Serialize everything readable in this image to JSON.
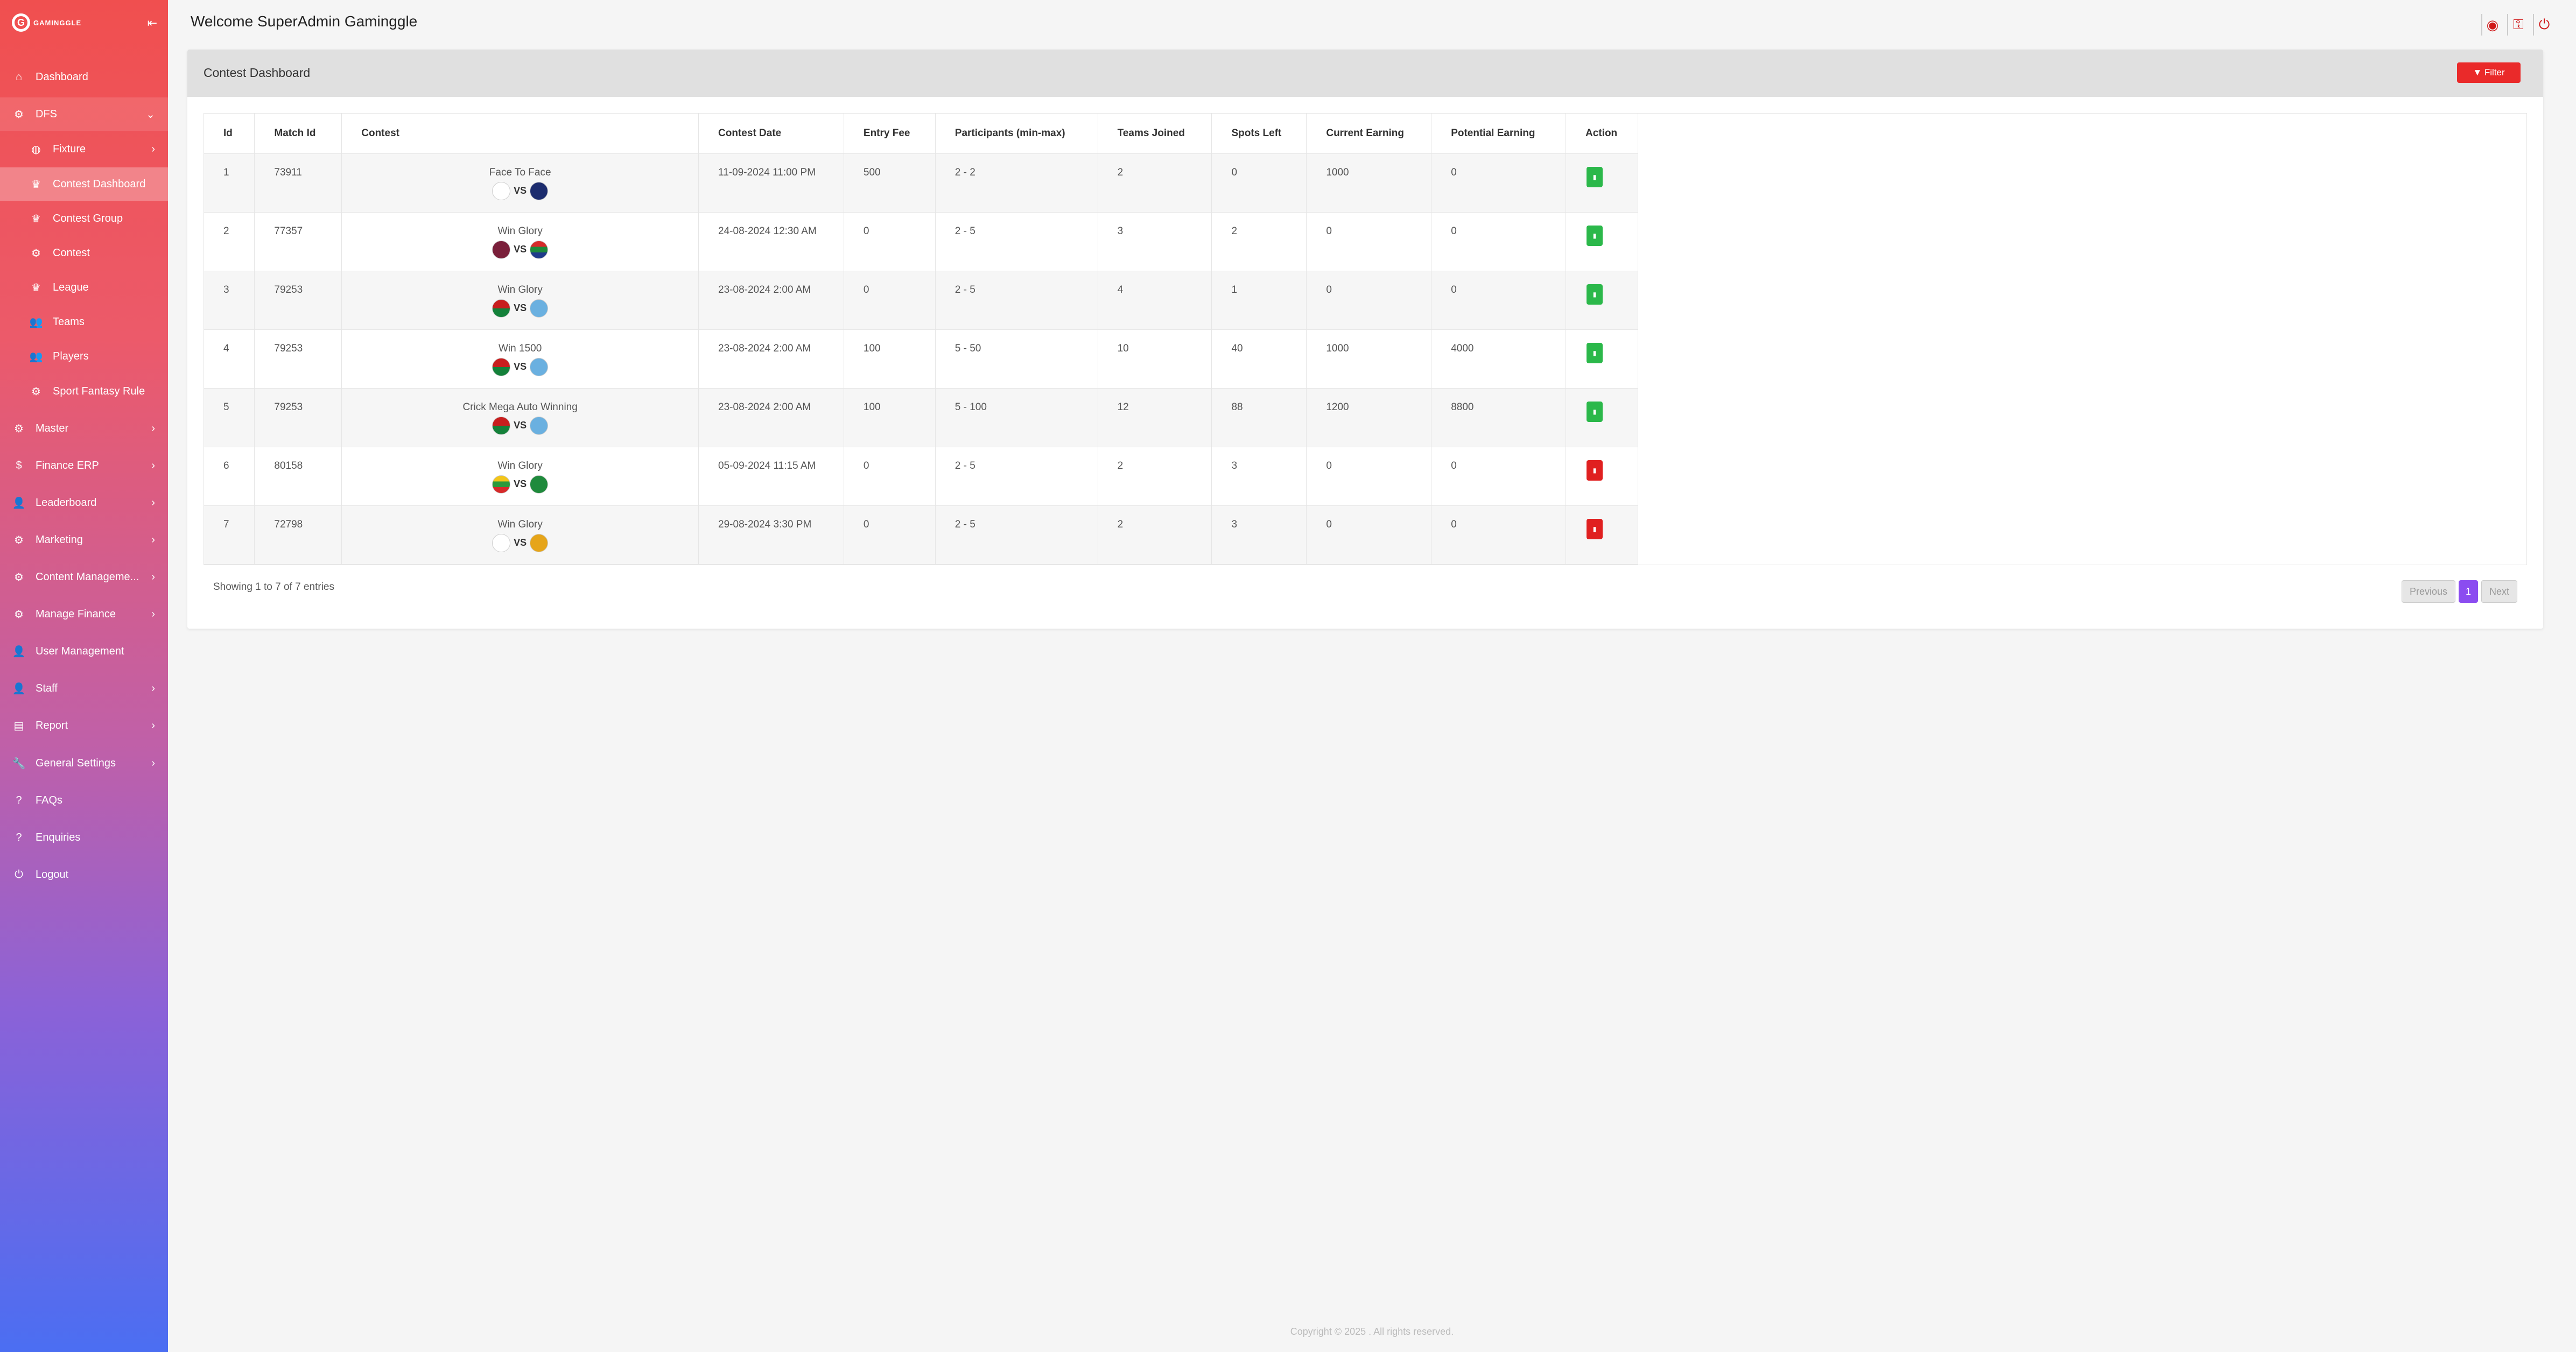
{
  "brand": {
    "logo_letter": "G",
    "name": "GAMINGGLE"
  },
  "sidebar": {
    "items": [
      {
        "name": "dashboard",
        "label": "Dashboard",
        "icon": "home-icon"
      },
      {
        "name": "dfs",
        "label": "DFS",
        "icon": "gear-icon",
        "expanded": true
      },
      {
        "name": "fixture",
        "label": "Fixture",
        "icon": "globe-icon",
        "sub": true
      },
      {
        "name": "contest-dashboard",
        "label": "Contest Dashboard",
        "icon": "trophy-icon",
        "sub": true,
        "active": true
      },
      {
        "name": "contest-group",
        "label": "Contest Group",
        "icon": "trophy-icon",
        "sub": true
      },
      {
        "name": "contest",
        "label": "Contest",
        "icon": "gear-icon",
        "sub": true
      },
      {
        "name": "league",
        "label": "League",
        "icon": "trophy-icon",
        "sub": true
      },
      {
        "name": "teams",
        "label": "Teams",
        "icon": "users-icon",
        "sub": true
      },
      {
        "name": "players",
        "label": "Players",
        "icon": "users-icon",
        "sub": true
      },
      {
        "name": "sport-fantasy-rule",
        "label": "Sport Fantasy Rule",
        "icon": "gear-icon",
        "sub": true
      },
      {
        "name": "master",
        "label": "Master",
        "icon": "cogs-icon"
      },
      {
        "name": "finance-erp",
        "label": "Finance ERP",
        "icon": "dollar-icon"
      },
      {
        "name": "leaderboard",
        "label": "Leaderboard",
        "icon": "user-icon"
      },
      {
        "name": "marketing",
        "label": "Marketing",
        "icon": "cogs-icon"
      },
      {
        "name": "content-management",
        "label": "Content Manageme...",
        "icon": "cogs-icon"
      },
      {
        "name": "manage-finance",
        "label": "Manage Finance",
        "icon": "cogs-icon"
      },
      {
        "name": "user-management",
        "label": "User Management",
        "icon": "user-icon"
      },
      {
        "name": "staff",
        "label": "Staff",
        "icon": "user-icon"
      },
      {
        "name": "report",
        "label": "Report",
        "icon": "file-icon"
      },
      {
        "name": "general-settings",
        "label": "General Settings",
        "icon": "wrench-icon"
      },
      {
        "name": "faqs",
        "label": "FAQs",
        "icon": "question-icon"
      },
      {
        "name": "enquiries",
        "label": "Enquiries",
        "icon": "question-icon"
      },
      {
        "name": "logout",
        "label": "Logout",
        "icon": "power-icon"
      }
    ]
  },
  "header": {
    "welcome": "Welcome SuperAdmin Gaminggle"
  },
  "card": {
    "title": "Contest Dashboard",
    "filter_label": "Filter"
  },
  "table": {
    "columns": [
      "Id",
      "Match Id",
      "Contest",
      "Contest Date",
      "Entry Fee",
      "Participants (min-max)",
      "Teams Joined",
      "Spots Left",
      "Current Earning",
      "Potential Earning",
      "Action"
    ],
    "rows": [
      {
        "id": "1",
        "match_id": "73911",
        "contest": "Face To Face",
        "team1_flag": "england",
        "team2_flag": "australia",
        "date": "11-09-2024 11:00 PM",
        "entry_fee": "500",
        "participants": "2 - 2",
        "joined": "2",
        "spots_left": "0",
        "current": "1000",
        "potential": "0",
        "action": "green"
      },
      {
        "id": "2",
        "match_id": "77357",
        "contest": "Win Glory",
        "team1_flag": "west-indies",
        "team2_flag": "south-africa",
        "date": "24-08-2024 12:30 AM",
        "entry_fee": "0",
        "participants": "2 - 5",
        "joined": "3",
        "spots_left": "2",
        "current": "0",
        "potential": "0",
        "action": "green"
      },
      {
        "id": "3",
        "match_id": "79253",
        "contest": "Win Glory",
        "team1_flag": "vanuatu",
        "team2_flag": "fiji",
        "date": "23-08-2024 2:00 AM",
        "entry_fee": "0",
        "participants": "2 - 5",
        "joined": "4",
        "spots_left": "1",
        "current": "0",
        "potential": "0",
        "action": "green"
      },
      {
        "id": "4",
        "match_id": "79253",
        "contest": "Win 1500",
        "team1_flag": "vanuatu",
        "team2_flag": "fiji",
        "date": "23-08-2024 2:00 AM",
        "entry_fee": "100",
        "participants": "5 - 50",
        "joined": "10",
        "spots_left": "40",
        "current": "1000",
        "potential": "4000",
        "action": "green"
      },
      {
        "id": "5",
        "match_id": "79253",
        "contest": "Crick Mega Auto Winning",
        "team1_flag": "vanuatu",
        "team2_flag": "fiji",
        "date": "23-08-2024 2:00 AM",
        "entry_fee": "100",
        "participants": "5 - 100",
        "joined": "12",
        "spots_left": "88",
        "current": "1200",
        "potential": "8800",
        "action": "green"
      },
      {
        "id": "6",
        "match_id": "80158",
        "contest": "Win Glory",
        "team1_flag": "myanmar",
        "team2_flag": "maldives",
        "date": "05-09-2024 11:15 AM",
        "entry_fee": "0",
        "participants": "2 - 5",
        "joined": "2",
        "spots_left": "3",
        "current": "0",
        "potential": "0",
        "action": "red"
      },
      {
        "id": "7",
        "match_id": "72798",
        "contest": "Win Glory",
        "team1_flag": "england",
        "team2_flag": "sri-lanka",
        "date": "29-08-2024 3:30 PM",
        "entry_fee": "0",
        "participants": "2 - 5",
        "joined": "2",
        "spots_left": "3",
        "current": "0",
        "potential": "0",
        "action": "red"
      }
    ],
    "vs_label": "VS"
  },
  "pagination": {
    "info": "Showing 1 to 7 of 7 entries",
    "previous": "Previous",
    "current": "1",
    "next": "Next"
  },
  "footer": {
    "copyright": "Copyright © 2025 . All rights reserved."
  },
  "colors": {
    "accent_red": "#ea2a2a",
    "action_green": "#2bb84a",
    "action_red": "#e02020",
    "page_current": "#8b4cf0"
  }
}
